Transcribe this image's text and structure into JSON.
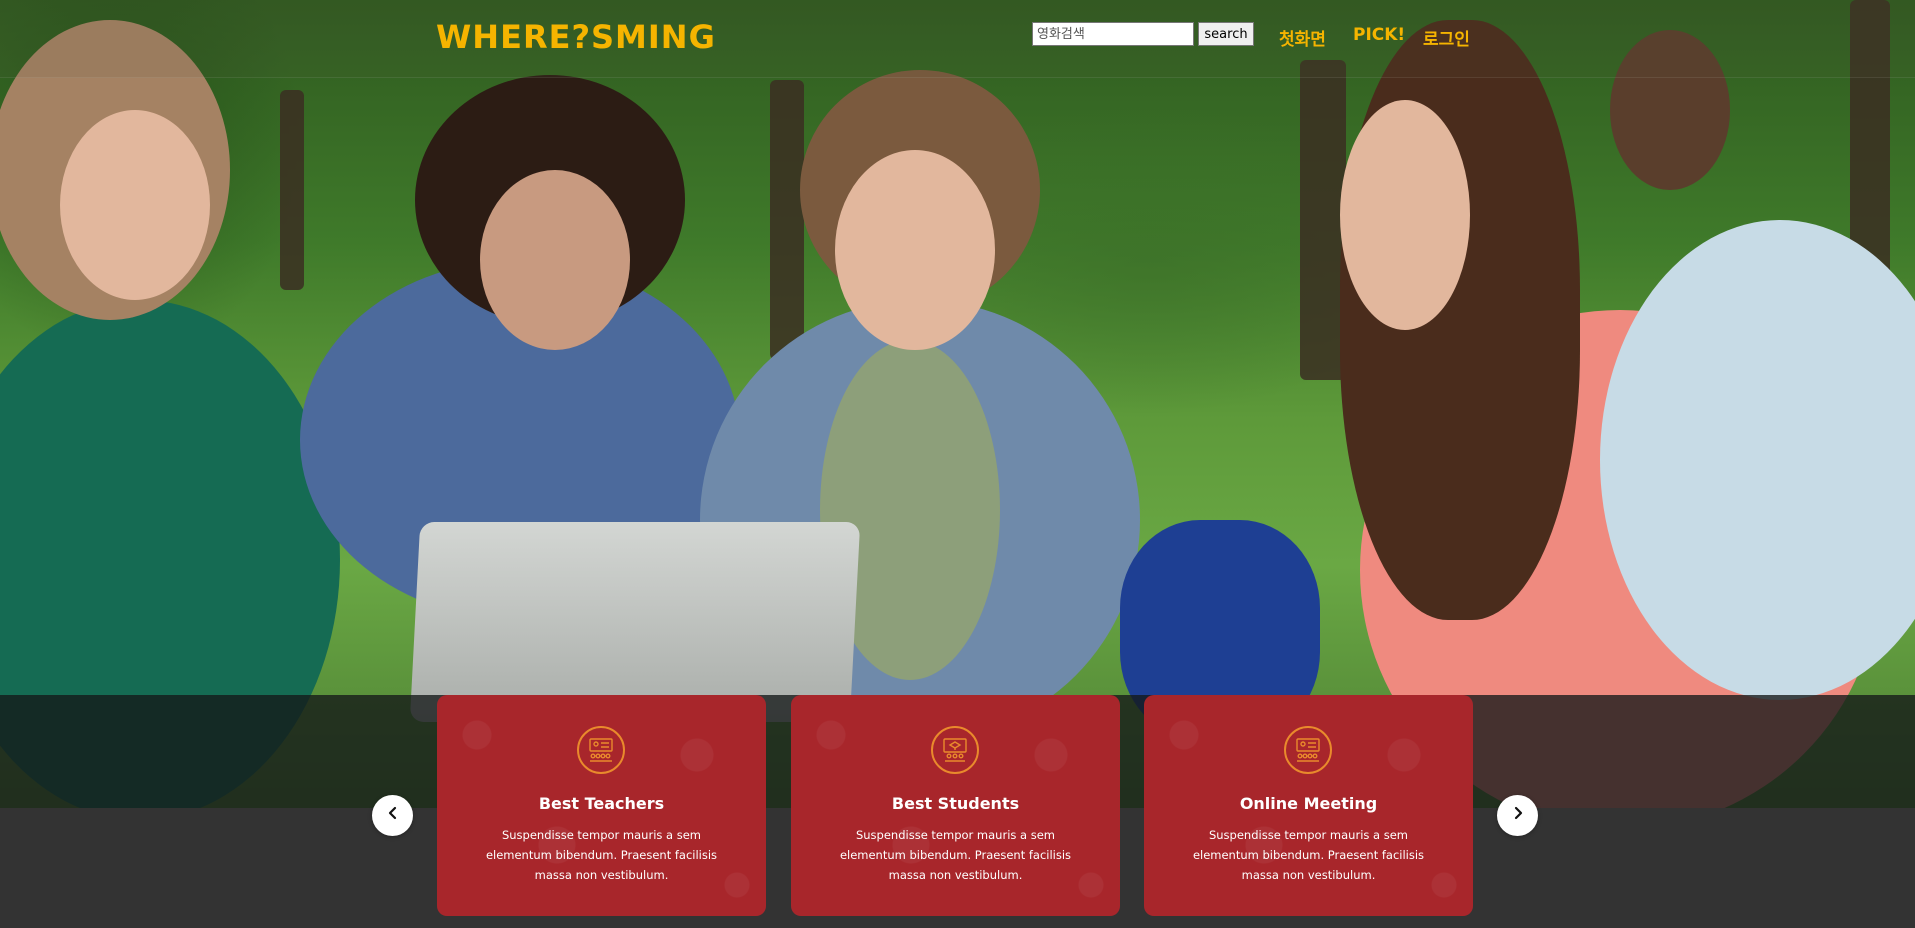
{
  "header": {
    "logo": "WHERE?SMING",
    "search": {
      "placeholder": "영화검색",
      "button_label": "search"
    },
    "nav": {
      "home": "첫화면",
      "pick": "PICK!",
      "login": "로그인"
    }
  },
  "carousel": {
    "cards": [
      {
        "icon": "teacher-board-icon",
        "title": "Best Teachers",
        "text": "Suspendisse tempor mauris a sem elementum bibendum. Praesent facilisis massa non vestibulum."
      },
      {
        "icon": "graduate-screen-icon",
        "title": "Best Students",
        "text": "Suspendisse tempor mauris a sem elementum bibendum. Praesent facilisis massa non vestibulum."
      },
      {
        "icon": "online-meeting-icon",
        "title": "Online Meeting",
        "text": "Suspendisse tempor mauris a sem elementum bibendum. Praesent facilisis massa non vestibulum."
      }
    ],
    "prev_icon": "chevron-left-icon",
    "next_icon": "chevron-right-icon"
  },
  "colors": {
    "accent": "#f5b400",
    "card_background": "#a8262b",
    "card_icon": "#e98a2c",
    "page_background": "#333333"
  }
}
